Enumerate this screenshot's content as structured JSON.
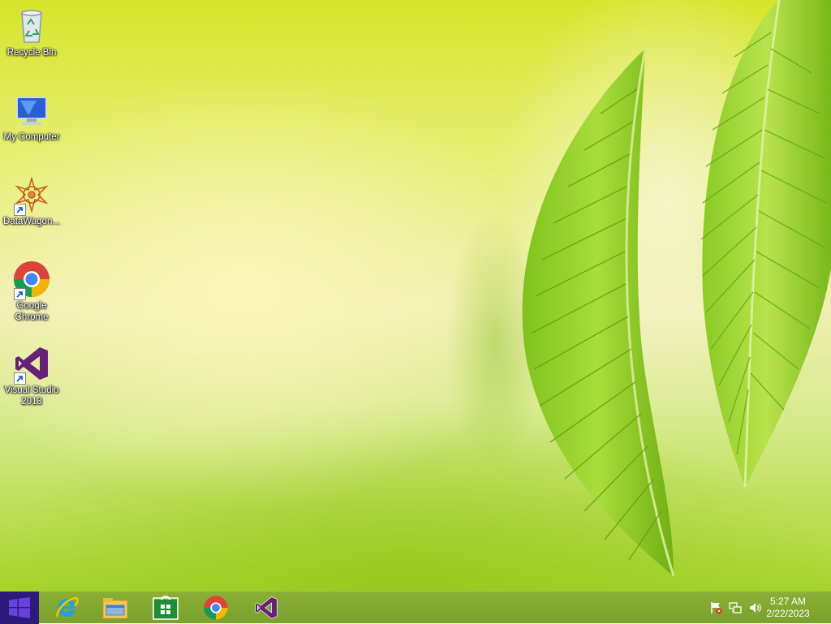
{
  "desktop": {
    "icons": [
      {
        "label": "Recycle Bin",
        "icon": "recycle-bin-icon"
      },
      {
        "label": "My Computer",
        "icon": "computer-icon"
      },
      {
        "label": "DataWagon...",
        "icon": "datawagon-icon"
      },
      {
        "label": "Google Chrome",
        "icon": "chrome-icon"
      },
      {
        "label": "Visual Studio 2013",
        "icon": "visual-studio-icon"
      }
    ]
  },
  "taskbar": {
    "start": "start-button",
    "pinned": [
      {
        "app": "Internet Explorer",
        "icon": "internet-explorer-icon"
      },
      {
        "app": "File Explorer",
        "icon": "file-explorer-icon"
      },
      {
        "app": "Store",
        "icon": "store-icon"
      },
      {
        "app": "Google Chrome",
        "icon": "chrome-icon"
      },
      {
        "app": "Visual Studio",
        "icon": "visual-studio-icon"
      }
    ],
    "tray": {
      "icons": [
        "action-center-flag-icon",
        "network-icon",
        "volume-icon"
      ],
      "time": "5:27 AM",
      "date": "2/22/2023"
    }
  },
  "colors": {
    "taskbar": "#7aa12b",
    "start": "#2c1b7a",
    "accent_windows": "#6a3fe0"
  }
}
